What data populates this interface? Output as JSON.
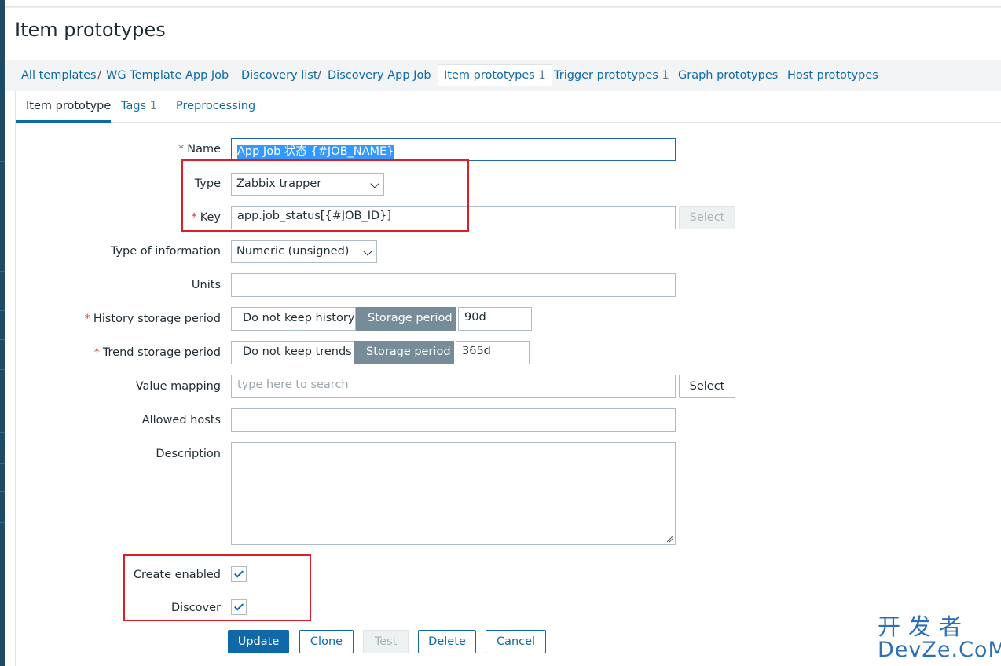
{
  "page": {
    "title": "Item prototypes"
  },
  "breadcrumbs": [
    {
      "label": "All templates"
    },
    {
      "label": "WG Template App Job"
    },
    {
      "label": "Discovery list"
    },
    {
      "label": "Discovery App Job"
    },
    {
      "label": "Item prototypes",
      "count": "1"
    },
    {
      "label": "Trigger prototypes",
      "count": "1"
    },
    {
      "label": "Graph prototypes"
    },
    {
      "label": "Host prototypes"
    }
  ],
  "breadcrumb_separator": "/",
  "tabs": [
    {
      "label": "Item prototype"
    },
    {
      "label": "Tags",
      "count": "1"
    },
    {
      "label": "Preprocessing"
    }
  ],
  "required_mark": "*",
  "form": {
    "name": {
      "label": "Name",
      "value": "App Job 状态 {#JOB_NAME}"
    },
    "type": {
      "label": "Type",
      "value": "Zabbix trapper"
    },
    "key": {
      "label": "Key",
      "value": "app.job_status[{#JOB_ID}]",
      "select_label": "Select"
    },
    "type_of_information": {
      "label": "Type of information",
      "value": "Numeric (unsigned)"
    },
    "units": {
      "label": "Units",
      "value": ""
    },
    "history": {
      "label": "History storage period",
      "option_off": "Do not keep history",
      "option_on": "Storage period",
      "value": "90d"
    },
    "trends": {
      "label": "Trend storage period",
      "option_off": "Do not keep trends",
      "option_on": "Storage period",
      "value": "365d"
    },
    "value_mapping": {
      "label": "Value mapping",
      "placeholder": "type here to search",
      "select_label": "Select"
    },
    "allowed_hosts": {
      "label": "Allowed hosts",
      "value": ""
    },
    "description": {
      "label": "Description",
      "value": ""
    },
    "create_enabled": {
      "label": "Create enabled",
      "checked": true
    },
    "discover": {
      "label": "Discover",
      "checked": true
    }
  },
  "buttons": {
    "update": "Update",
    "clone": "Clone",
    "test": "Test",
    "delete": "Delete",
    "cancel": "Cancel"
  },
  "watermark": {
    "top": "开发者",
    "bottom": "DevZe.CoM"
  },
  "colors": {
    "accent": "#0f69a8",
    "highlight_box": "#d9202a",
    "segment_active": "#768d99"
  }
}
